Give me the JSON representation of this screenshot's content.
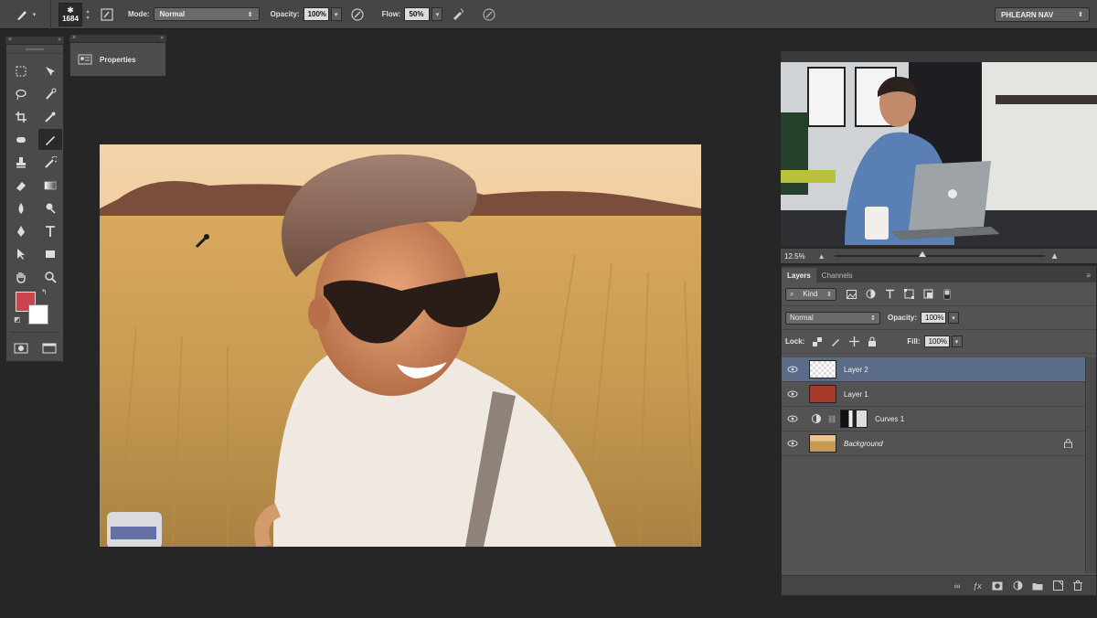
{
  "options_bar": {
    "brush_size": "1684",
    "mode_label": "Mode:",
    "mode_value": "Normal",
    "opacity_label": "Opacity:",
    "opacity_value": "100%",
    "flow_label": "Flow:",
    "flow_value": "50%",
    "workspace": "PHLEARN NAV"
  },
  "panels": {
    "properties_label": "Properties",
    "zoom_level": "12.5%"
  },
  "layers_panel": {
    "tabs": [
      {
        "label": "Layers",
        "active": true
      },
      {
        "label": "Channels",
        "active": false
      }
    ],
    "filter_kind": "Kind",
    "blend_mode": "Normal",
    "opacity_label": "Opacity:",
    "opacity_value": "100%",
    "lock_label": "Lock:",
    "fill_label": "Fill:",
    "fill_value": "100%",
    "layers": [
      {
        "name": "Layer 2",
        "selected": true
      },
      {
        "name": "Layer 1",
        "selected": false
      },
      {
        "name": "Curves 1",
        "selected": false
      },
      {
        "name": "Background",
        "selected": false
      }
    ]
  },
  "colors": {
    "foreground": "#c9444e",
    "background": "#ffffff",
    "layer1_fill": "#a6382c",
    "selection": "#5b6c89"
  }
}
